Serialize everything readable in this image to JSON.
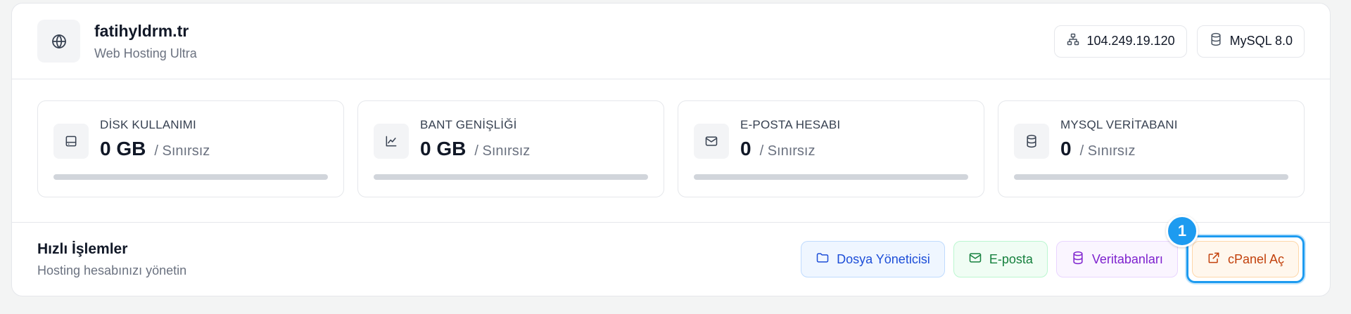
{
  "header": {
    "site_name": "fatihyldrm.tr",
    "plan": "Web Hosting Ultra",
    "ip": "104.249.19.120",
    "db_version": "MySQL 8.0"
  },
  "stats": [
    {
      "label": "DİSK KULLANIMI",
      "value": "0 GB",
      "limit": "/ Sınırsız",
      "icon": "hard-drive-icon",
      "progress": 0
    },
    {
      "label": "BANT GENİŞLİĞİ",
      "value": "0 GB",
      "limit": "/ Sınırsız",
      "icon": "chart-line-icon",
      "progress": 0
    },
    {
      "label": "E-POSTA HESABI",
      "value": "0",
      "limit": "/ Sınırsız",
      "icon": "mail-icon",
      "progress": 0
    },
    {
      "label": "MYSQL VERİTABANI",
      "value": "0",
      "limit": "/ Sınırsız",
      "icon": "database-icon",
      "progress": 0
    }
  ],
  "quick_actions": {
    "title": "Hızlı İşlemler",
    "subtitle": "Hosting hesabınızı yönetin",
    "buttons": [
      {
        "label": "Dosya Yöneticisi",
        "icon": "folder-icon",
        "color": "#1d4ed8"
      },
      {
        "label": "E-posta",
        "icon": "mail-icon",
        "color": "#15803d"
      },
      {
        "label": "Veritabanları",
        "icon": "database-icon",
        "color": "#7e22ce"
      },
      {
        "label": "cPanel Aç",
        "icon": "external-link-icon",
        "color": "#c2410c"
      }
    ],
    "highlight_badge": "1"
  },
  "colors": {
    "highlight": "#1d9bf0",
    "progress_track": "#d1d5db"
  }
}
